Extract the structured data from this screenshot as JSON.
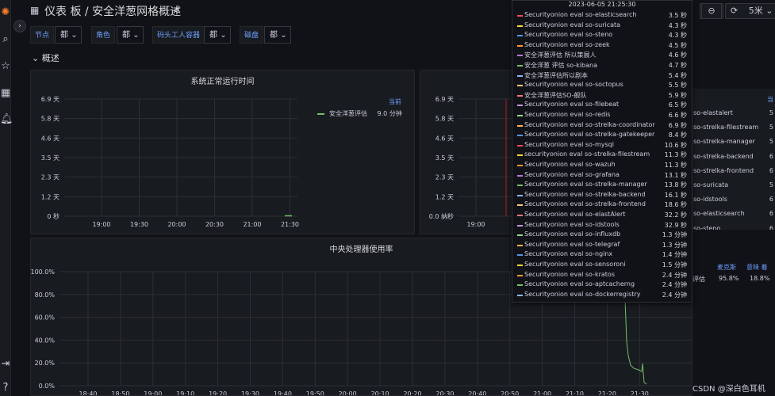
{
  "header": {
    "title": "仪表 板 / 安全洋葱网格概述",
    "refresh_interval": "5米"
  },
  "variables": [
    {
      "label": "节点",
      "value": "都"
    },
    {
      "label": "角色",
      "value": "都"
    },
    {
      "label": "码头工人容器",
      "value": "都"
    },
    {
      "label": "磁盘",
      "value": "都"
    }
  ],
  "row": {
    "title": "概述"
  },
  "uptime_panel": {
    "title": "系统正常运行时间",
    "y_ticks": [
      "6.9 天",
      "5.8 天",
      "4.6 天",
      "3.5 天",
      "2.3 天",
      "1.2 天",
      "0 秒"
    ],
    "x_ticks": [
      "19:00",
      "19:30",
      "20:00",
      "20:30",
      "21:00",
      "21:30"
    ],
    "legend_header": "当前",
    "legend": [
      {
        "name": "安全洋葱评估",
        "value": "9.0 分钟",
        "color": "#73bf69"
      }
    ]
  },
  "second_panel": {
    "y_ticks": [
      "6.9 天",
      "5.8 天",
      "4.6 天",
      "3.5 天",
      "2.3 天",
      "1.2 天",
      "0.0 纳秒"
    ],
    "x_ticks": [
      "19:00"
    ]
  },
  "cpu_panel": {
    "title": "中央处理器使用率",
    "y_ticks": [
      "100.0%",
      "80.0%",
      "60.0%",
      "40.0%",
      "20.0%",
      "0.0%"
    ],
    "x_ticks": [
      "18:40",
      "18:50",
      "19:00",
      "19:10",
      "19:20",
      "19:30",
      "19:40",
      "19:50",
      "20:00",
      "20:10",
      "20:20",
      "20:30",
      "20:40",
      "20:50",
      "21:00",
      "21:10",
      "21:20",
      "21:30"
    ]
  },
  "tooltip": {
    "time": "2023-06-05 21:25:30",
    "rows": [
      {
        "name": "Securityonion eval so-elasticsearch",
        "value": "3.5 秒",
        "color": "#f2495c"
      },
      {
        "name": "Securityonion eval so-suricata",
        "value": "4.3 秒",
        "color": "#fade2a"
      },
      {
        "name": "Securityonion eval so-steno",
        "value": "4.3 秒",
        "color": "#5794f2"
      },
      {
        "name": "Securityonion eval so-zeek",
        "value": "4.5 秒",
        "color": "#ff9830"
      },
      {
        "name": "安全洋葱评估 所以策展人",
        "value": "4.6 秒",
        "color": "#b877d9"
      },
      {
        "name": "安全洋葱 评估 so-kibana",
        "value": "4.7 秒",
        "color": "#73bf69"
      },
      {
        "name": "安全洋葱评估所以剧本",
        "value": "5.4 秒",
        "color": "#8ab8ff"
      },
      {
        "name": "Securityonion eval so-soctopus",
        "value": "5.5 秒",
        "color": "#ffcb7d"
      },
      {
        "name": "安全洋葱评估SO-舰队",
        "value": "5.9 秒",
        "color": "#ff7383"
      },
      {
        "name": "Securityonion eval so-filebeat",
        "value": "6.5 秒",
        "color": "#ca95e5"
      },
      {
        "name": "Securityonion eval so-redis",
        "value": "6.6 秒",
        "color": "#96d98d"
      },
      {
        "name": "Securityonion eval so-strelka-coordinator",
        "value": "6.9 秒",
        "color": "#ffb357"
      },
      {
        "name": "Securityonion eval so-strelka-gatekeeper",
        "value": "8.4 秒",
        "color": "#5794f2"
      },
      {
        "name": "Securityonion eval so-mysql",
        "value": "10.6 秒",
        "color": "#f2495c"
      },
      {
        "name": "securityonion eval so-strelka-filestream",
        "value": "11.3 秒",
        "color": "#fade2a"
      },
      {
        "name": "Securityonion eval so-wazuh",
        "value": "11.3 秒",
        "color": "#ff9830"
      },
      {
        "name": "Securityonion eval so-grafana",
        "value": "13.1 秒",
        "color": "#b877d9"
      },
      {
        "name": "Securityonion eval so-strelka-manager",
        "value": "13.8 秒",
        "color": "#73bf69"
      },
      {
        "name": "Securityonion eval so-strelka-backend",
        "value": "16.1 秒",
        "color": "#8ab8ff"
      },
      {
        "name": "Securityonion eval so-strelka-frontend",
        "value": "18.6 秒",
        "color": "#ffcb7d"
      },
      {
        "name": "Securityonion eval so-elastAlert",
        "value": "32.2 秒",
        "color": "#ff7383"
      },
      {
        "name": "Securityonion eval so-idstools",
        "value": "32.9 秒",
        "color": "#ca95e5"
      },
      {
        "name": "Securityonion eval so-influxdb",
        "value": "1.3 分钟",
        "color": "#96d98d"
      },
      {
        "name": "Securityonion eval so-telegraf",
        "value": "1.3 分钟",
        "color": "#ffb357"
      },
      {
        "name": "Securityonion eval so-nginx",
        "value": "1.4 分钟",
        "color": "#5794f2"
      },
      {
        "name": "Securityonion eval so-sensoroni",
        "value": "1.5 分钟",
        "color": "#fade2a"
      },
      {
        "name": "Securityonion eval so-kratos",
        "value": "2.4 分钟",
        "color": "#ff9830"
      },
      {
        "name": "Securityonion eval so-aptcacherng",
        "value": "2.4 分钟",
        "color": "#73bf69"
      },
      {
        "name": "Securityonion eval so-dockerregistry",
        "value": "2.4 分钟",
        "color": "#8ab8ff"
      }
    ]
  },
  "right_list": {
    "header": "当",
    "items": [
      {
        "name": "so-elastalert",
        "value": "5"
      },
      {
        "name": "so-strelka-filestream",
        "value": "5"
      },
      {
        "name": "so-strelka-manager",
        "value": "5"
      },
      {
        "name": "so-strelka-backend",
        "value": "6"
      },
      {
        "name": "so-strelka-frontend",
        "value": "6"
      },
      {
        "name": "so-suricata",
        "value": "5"
      },
      {
        "name": "so-idstools",
        "value": "6"
      },
      {
        "name": "so-elasticsearch",
        "value": "6"
      },
      {
        "name": "so-steno",
        "value": "6"
      }
    ]
  },
  "right_table": {
    "headers": [
      "麦克斯",
      "意味 着"
    ],
    "row": {
      "name": "评估",
      "max": "95.8%",
      "mean": "18.8%"
    }
  },
  "watermark": "CSDN @深白色耳机"
}
